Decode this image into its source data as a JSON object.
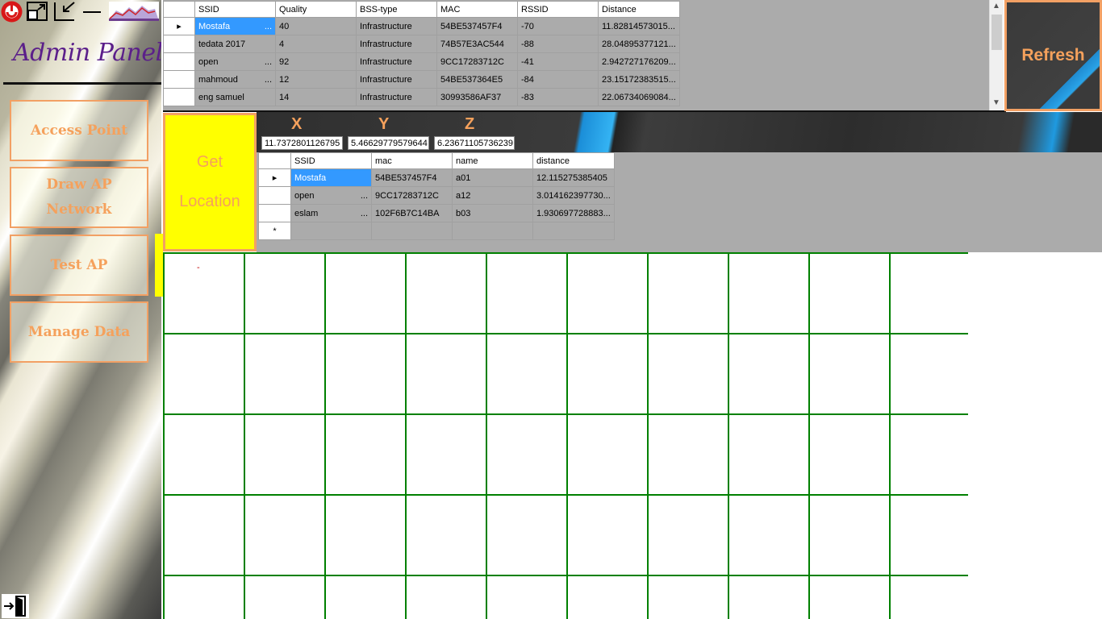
{
  "sidebar": {
    "title": "Admin Panel",
    "buttons": {
      "access_point": "Access Point",
      "draw_ap_line1": "Draw AP",
      "draw_ap_line2": "Network",
      "test_ap": "Test AP",
      "manage_data": "Manage Data"
    },
    "icons": [
      "app-logo-icon",
      "maximize-icon",
      "restore-icon",
      "minimize-icon",
      "chart-logo-icon",
      "exit-door-icon"
    ]
  },
  "top_grid": {
    "columns": [
      "SSID",
      "Quality",
      "BSS-type",
      "MAC",
      "RSSID",
      "Distance"
    ],
    "rows": [
      {
        "ssid": "Mostafa",
        "quality": "40",
        "bss": "Infrastructure",
        "mac": "54BE537457F4",
        "rssid": "-70",
        "distance": "11.82814573015..."
      },
      {
        "ssid": "tedata 2017",
        "quality": "4",
        "bss": "Infrastructure",
        "mac": "74B57E3AC544",
        "rssid": "-88",
        "distance": "28.04895377121..."
      },
      {
        "ssid": "open",
        "quality": "92",
        "bss": "Infrastructure",
        "mac": "9CC17283712C",
        "rssid": "-41",
        "distance": "2.942727176209..."
      },
      {
        "ssid": "mahmoud",
        "quality": "12",
        "bss": "Infrastructure",
        "mac": "54BE537364E5",
        "rssid": "-84",
        "distance": "23.15172383515..."
      },
      {
        "ssid": "eng samuel",
        "quality": "14",
        "bss": "Infrastructure",
        "mac": "30993586AF37",
        "rssid": "-83",
        "distance": "22.06734069084..."
      }
    ]
  },
  "refresh_label": "Refresh",
  "location": {
    "button_line1": "Get",
    "button_line2": "Location",
    "x_label": "X",
    "y_label": "Y",
    "z_label": "Z",
    "x_value": "11.7372801126795",
    "y_value": "5.46629779579644",
    "z_value": "6.23671105736239"
  },
  "ap_grid": {
    "columns": [
      "SSID",
      "mac",
      "name",
      "distance"
    ],
    "rows": [
      {
        "ssid": "Mostafa",
        "mac": "54BE537457F4",
        "name": "a01",
        "distance": "12.115275385405"
      },
      {
        "ssid": "open",
        "mac": "9CC17283712C",
        "name": "a12",
        "distance": "3.014162397730..."
      },
      {
        "ssid": "eslam",
        "mac": "102F6B7C14BA",
        "name": "b03",
        "distance": "1.930697728883..."
      }
    ],
    "new_row_marker": "*"
  },
  "canvas": {
    "marker_text": "-",
    "grid_color": "#008000"
  },
  "colors": {
    "accent_orange": "#f5a15c",
    "selection_blue": "#3399ff",
    "get_location_yellow": "#ffff00",
    "title_purple": "#5b1f8a"
  }
}
